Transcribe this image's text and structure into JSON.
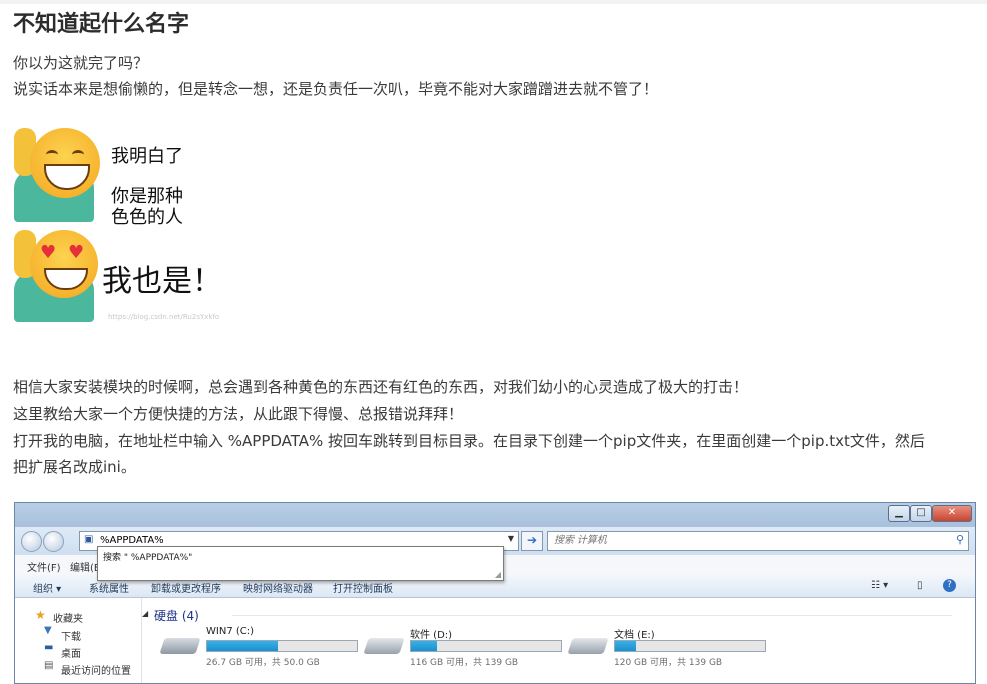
{
  "title": "不知道起什么名字",
  "intro": {
    "line1": "你以为这就完了吗？",
    "line2": "说实话本来是想偷懒的，但是转念一想，还是负责任一次叭，毕竟不能对大家蹭蹭进去就不管了！"
  },
  "meme": {
    "text1": "我明白了",
    "text2a": "你是那种",
    "text2b": "色色的人",
    "text3": "我也是！",
    "watermark": "https://blog.csdn.net/Ru2sYxkfo"
  },
  "body": {
    "line1": "相信大家安装模块的时候啊，总会遇到各种黄色的东西还有红色的东西，对我们幼小的心灵造成了极大的打击！",
    "line2": "这里教给大家一个方便快捷的方法，从此跟下得慢、总报错说拜拜！",
    "line3": "打开我的电脑，在地址栏中输入 %APPDATA% 按回车跳转到目标目录。在目录下创建一个pip文件夹，在里面创建一个pip.txt文件，然后",
    "line4": "把扩展名改成ini。"
  },
  "explorer": {
    "address_value": "%APPDATA%",
    "search_placeholder": "搜索 计算机",
    "suggestion": "搜索 \" %APPDATA%\"",
    "menu": [
      "文件(F)",
      "编辑(E)"
    ],
    "toolbar": [
      "组织 ▾",
      "系统属性",
      "卸载或更改程序",
      "映射网络驱动器",
      "打开控制面板"
    ],
    "nav_items": [
      "收藏夹",
      "下载",
      "桌面",
      "最近访问的位置"
    ],
    "section": "硬盘 (4)",
    "drives": [
      {
        "name": "WIN7 (C:)",
        "size": "26.7 GB 可用，共 50.0 GB",
        "used_fraction": 0.47
      },
      {
        "name": "软件 (D:)",
        "size": "116 GB 可用，共 139 GB",
        "used_fraction": 0.17
      },
      {
        "name": "文档 (E:)",
        "size": "120 GB 可用，共 139 GB",
        "used_fraction": 0.14
      }
    ]
  }
}
